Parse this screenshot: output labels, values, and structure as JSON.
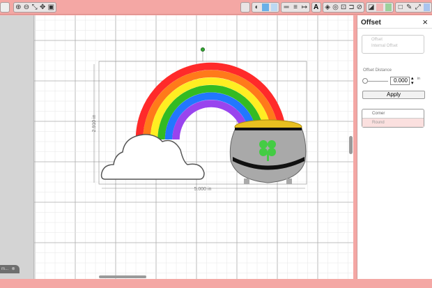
{
  "toolbar": {
    "left_icons": [
      "zoom-in-icon",
      "zoom-out-icon",
      "zoom-fit-icon",
      "pan-icon",
      "fullpage-icon"
    ],
    "right_icons": [
      "save-icon",
      "color-icon",
      "fill-icon",
      "grid-icon",
      "align-icon",
      "distribute-icon",
      "line-icon",
      "text-icon",
      "node-icon",
      "weld-icon",
      "shadow-icon",
      "offset-icon",
      "trace-icon",
      "layers-icon",
      "pattern-icon",
      "knife-icon",
      "eraser-icon",
      "pencil-icon",
      "expand-icon",
      "panel-icon"
    ]
  },
  "canvas": {
    "width_label": "5.000 in",
    "height_label": "2.910 in",
    "colors": {
      "rainbow": [
        "#ff2a2a",
        "#ff7a1a",
        "#ffee22",
        "#33bb22",
        "#2277ff",
        "#9944ee"
      ],
      "pot": "#a9a9a9",
      "shamrock": "#44cc44",
      "gold": "#e8c020"
    }
  },
  "panel": {
    "title": "Offset",
    "close": "×",
    "options": [
      "Offset",
      "Internal Offset"
    ],
    "distance_label": "Offset Distance",
    "distance_value": "0.000",
    "unit": "in",
    "apply": "Apply",
    "corner": "Corner",
    "round": "Round"
  },
  "tab": {
    "label": "m..."
  }
}
